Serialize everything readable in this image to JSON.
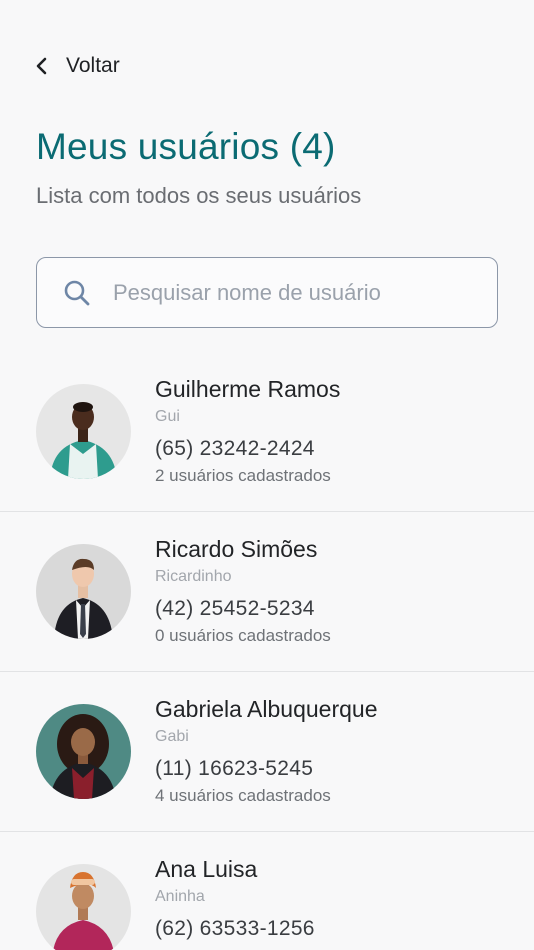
{
  "header": {
    "back_label": "Voltar"
  },
  "page": {
    "title": "Meus usuários (4)",
    "subtitle": "Lista com todos os seus usuários"
  },
  "search": {
    "placeholder": "Pesquisar nome de usuário",
    "value": ""
  },
  "users": [
    {
      "name": "Guilherme Ramos",
      "nickname": "Gui",
      "phone": "(65) 23242-2424",
      "registered": "2 usuários cadastrados"
    },
    {
      "name": "Ricardo Simões",
      "nickname": "Ricardinho",
      "phone": "(42) 25452-5234",
      "registered": "0 usuários cadastrados"
    },
    {
      "name": "Gabriela Albuquerque",
      "nickname": "Gabi",
      "phone": "(11) 16623-5245",
      "registered": "4 usuários cadastrados"
    },
    {
      "name": "Ana Luisa",
      "nickname": "Aninha",
      "phone": "(62) 63533-1256",
      "registered": ""
    }
  ],
  "colors": {
    "accent": "#0b6b73",
    "background": "#f8f8f9",
    "border": "#8c97a8"
  },
  "icons": {
    "back": "chevron-left-icon",
    "search": "search-icon"
  }
}
